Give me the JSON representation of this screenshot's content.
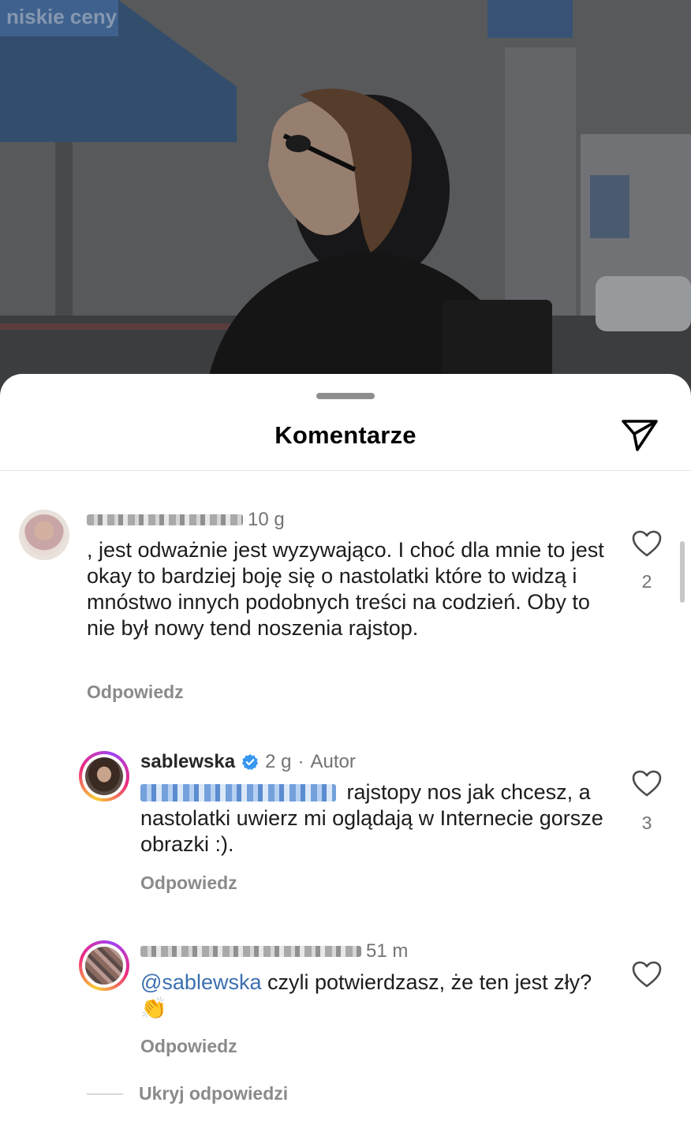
{
  "sheet": {
    "title": "Komentarze"
  },
  "background_photo": {
    "sign_text": "niskie ceny"
  },
  "comments": [
    {
      "time": "10 g",
      "text": ", jest odważnie jest wyzywająco.  I choć dla mnie to jest okay to bardziej boję się o nastolatki które to widzą i mnóstwo innych podobnych treści na codzień.  Oby to nie był nowy tend noszenia rajstop.",
      "reply_label": "Odpowiedz",
      "likes": "2"
    },
    {
      "username": "sablewska",
      "time": "2 g",
      "separator": "·",
      "author_label": "Autor",
      "text": "rajstopy nos jak chcesz, a nastolatki uwierz mi oglądają w Internecie gorsze obrazki :).",
      "reply_label": "Odpowiedz",
      "likes": "3"
    },
    {
      "time": "51 m",
      "mention": "@sablewska",
      "text": "czyli potwierdzasz, że ten jest zły?",
      "emoji": "👏",
      "reply_label": "Odpowiedz"
    }
  ],
  "hide_replies_label": "Ukryj odpowiedzi",
  "icons": {
    "share": "paper-plane-icon",
    "like": "heart-outline-icon",
    "verified": "verified-badge-icon"
  },
  "colors": {
    "mention": "#3b6fb0",
    "verified": "#3797f0",
    "secondary_text": "#737373"
  }
}
